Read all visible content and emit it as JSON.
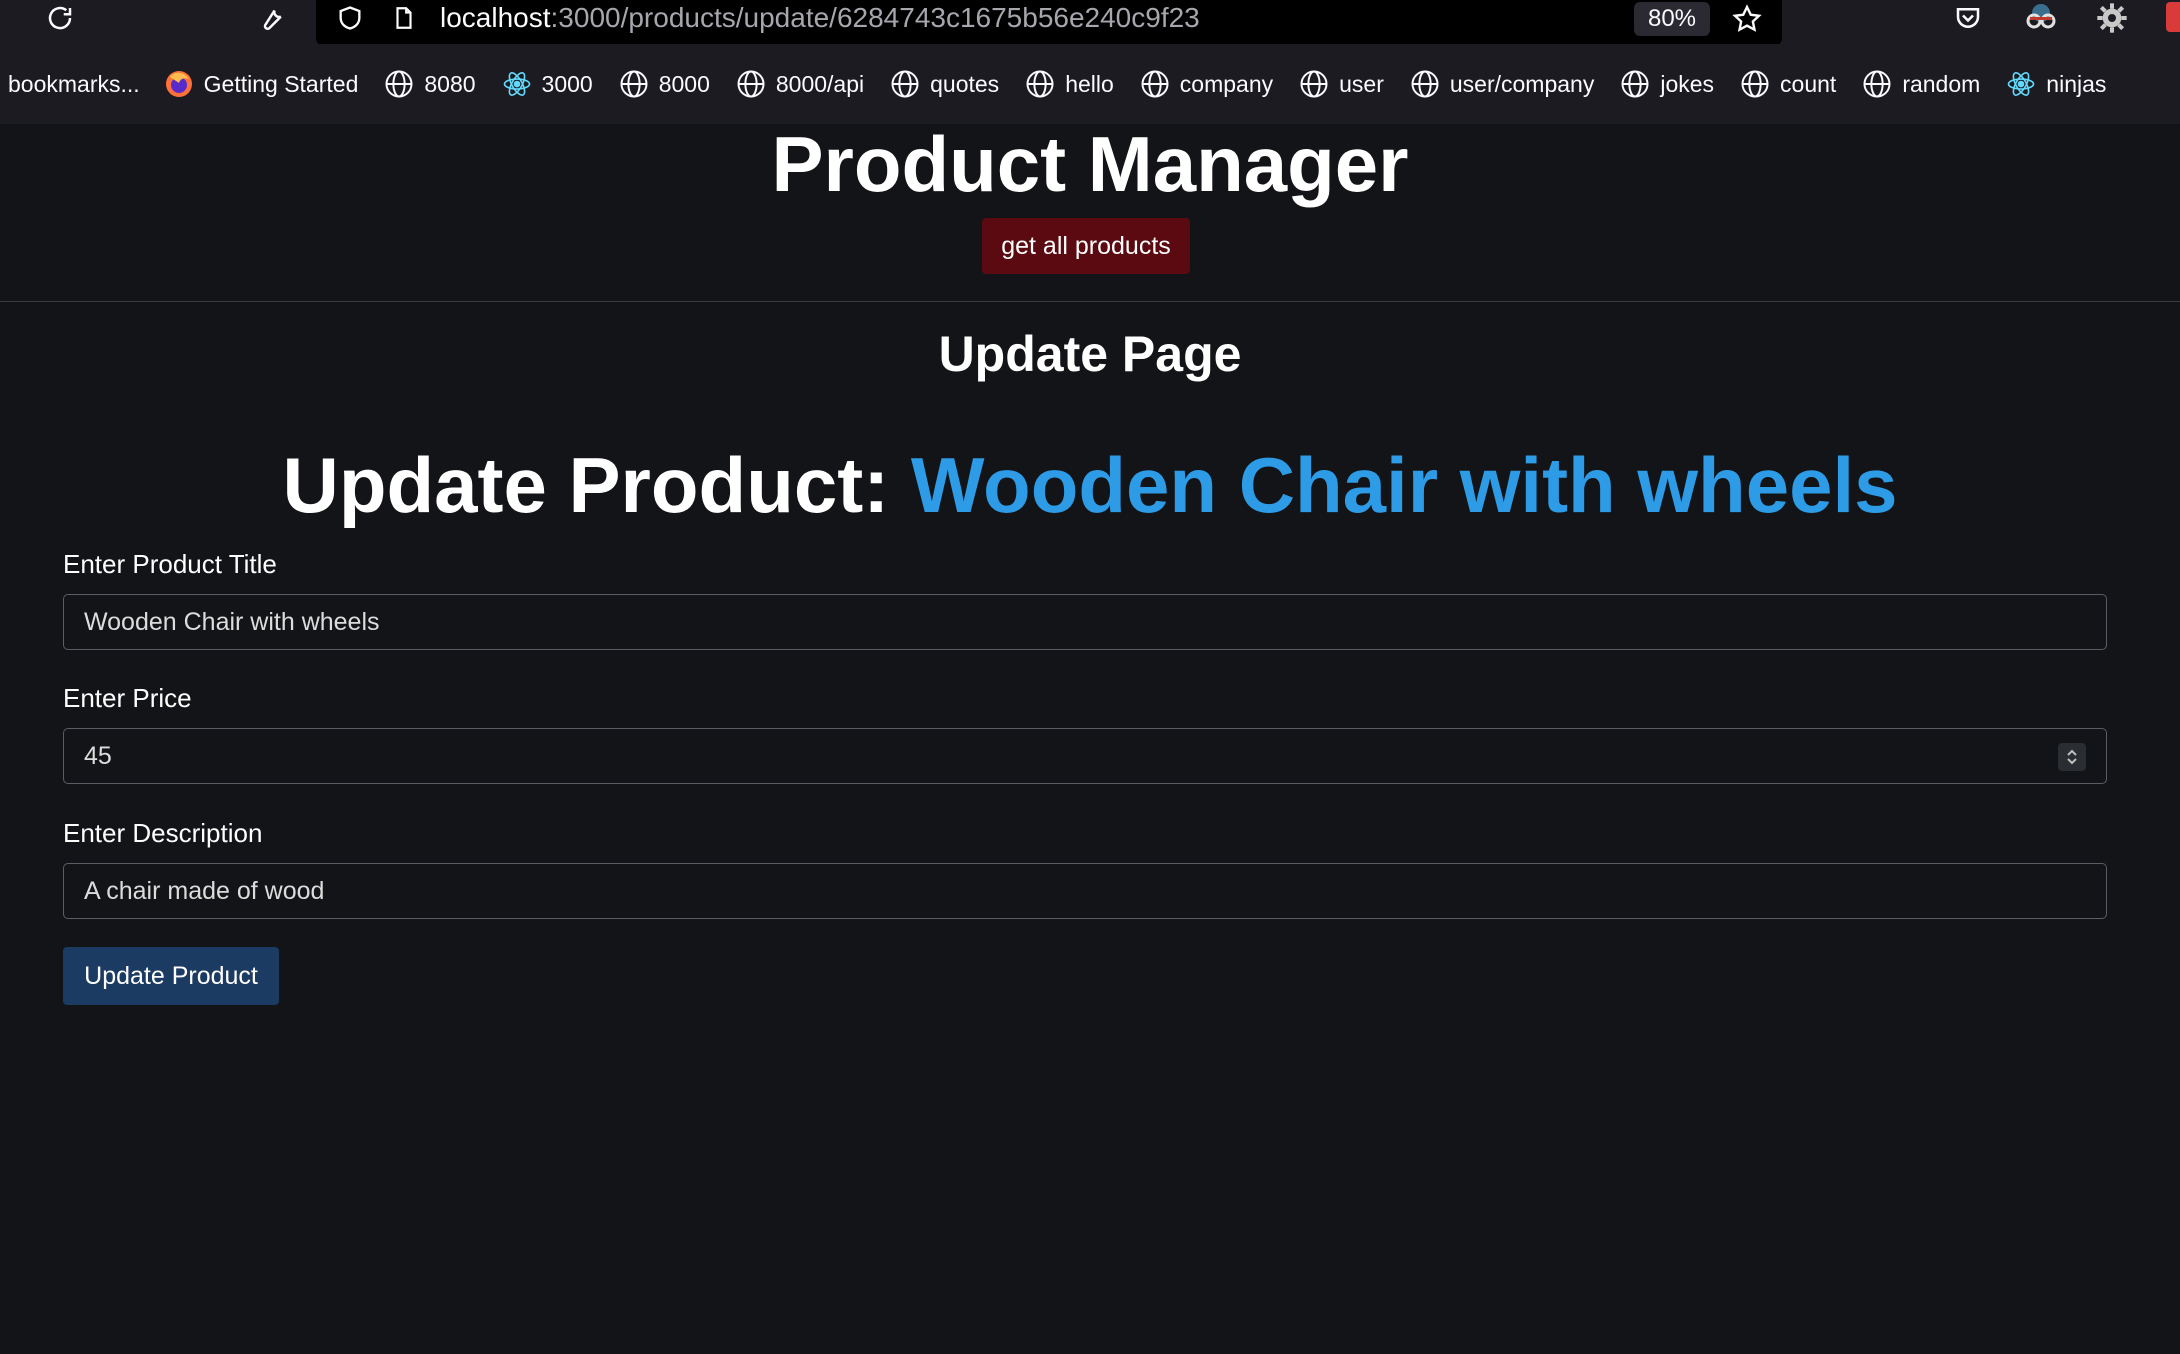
{
  "browser": {
    "url_host": "localhost",
    "url_path": ":3000/products/update/6284743c1675b56e240c9f23",
    "zoom": "80%",
    "icons": [
      "reload-icon",
      "wrench-icon",
      "shield-icon",
      "page-icon",
      "star-icon",
      "pocket-icon",
      "extension-icon",
      "gear-icon"
    ],
    "bookmarks": [
      {
        "label": "bookmarks...",
        "icon": "none"
      },
      {
        "label": "Getting Started",
        "icon": "firefox-icon"
      },
      {
        "label": "8080",
        "icon": "globe-icon"
      },
      {
        "label": "3000",
        "icon": "react-icon"
      },
      {
        "label": "8000",
        "icon": "globe-icon"
      },
      {
        "label": "8000/api",
        "icon": "globe-icon"
      },
      {
        "label": "quotes",
        "icon": "globe-icon"
      },
      {
        "label": "hello",
        "icon": "globe-icon"
      },
      {
        "label": "company",
        "icon": "globe-icon"
      },
      {
        "label": "user",
        "icon": "globe-icon"
      },
      {
        "label": "user/company",
        "icon": "globe-icon"
      },
      {
        "label": "jokes",
        "icon": "globe-icon"
      },
      {
        "label": "count",
        "icon": "globe-icon"
      },
      {
        "label": "random",
        "icon": "globe-icon"
      },
      {
        "label": "ninjas",
        "icon": "react-icon"
      }
    ]
  },
  "app": {
    "title": "Product Manager",
    "nav_button": "get all products",
    "page_title": "Update Page"
  },
  "form": {
    "heading_prefix": "Update Product: ",
    "heading_product": "Wooden Chair with wheels",
    "title_label": "Enter Product Title",
    "title_value": "Wooden Chair with wheels",
    "price_label": "Enter Price",
    "price_value": "45",
    "description_label": "Enter Description",
    "description_value": "A chair made of wood",
    "submit_label": "Update Product"
  },
  "colors": {
    "background": "#121417",
    "accent_blue": "#2d9be6",
    "nav_button": "#5c0a12",
    "submit_button": "#1c3b62"
  }
}
